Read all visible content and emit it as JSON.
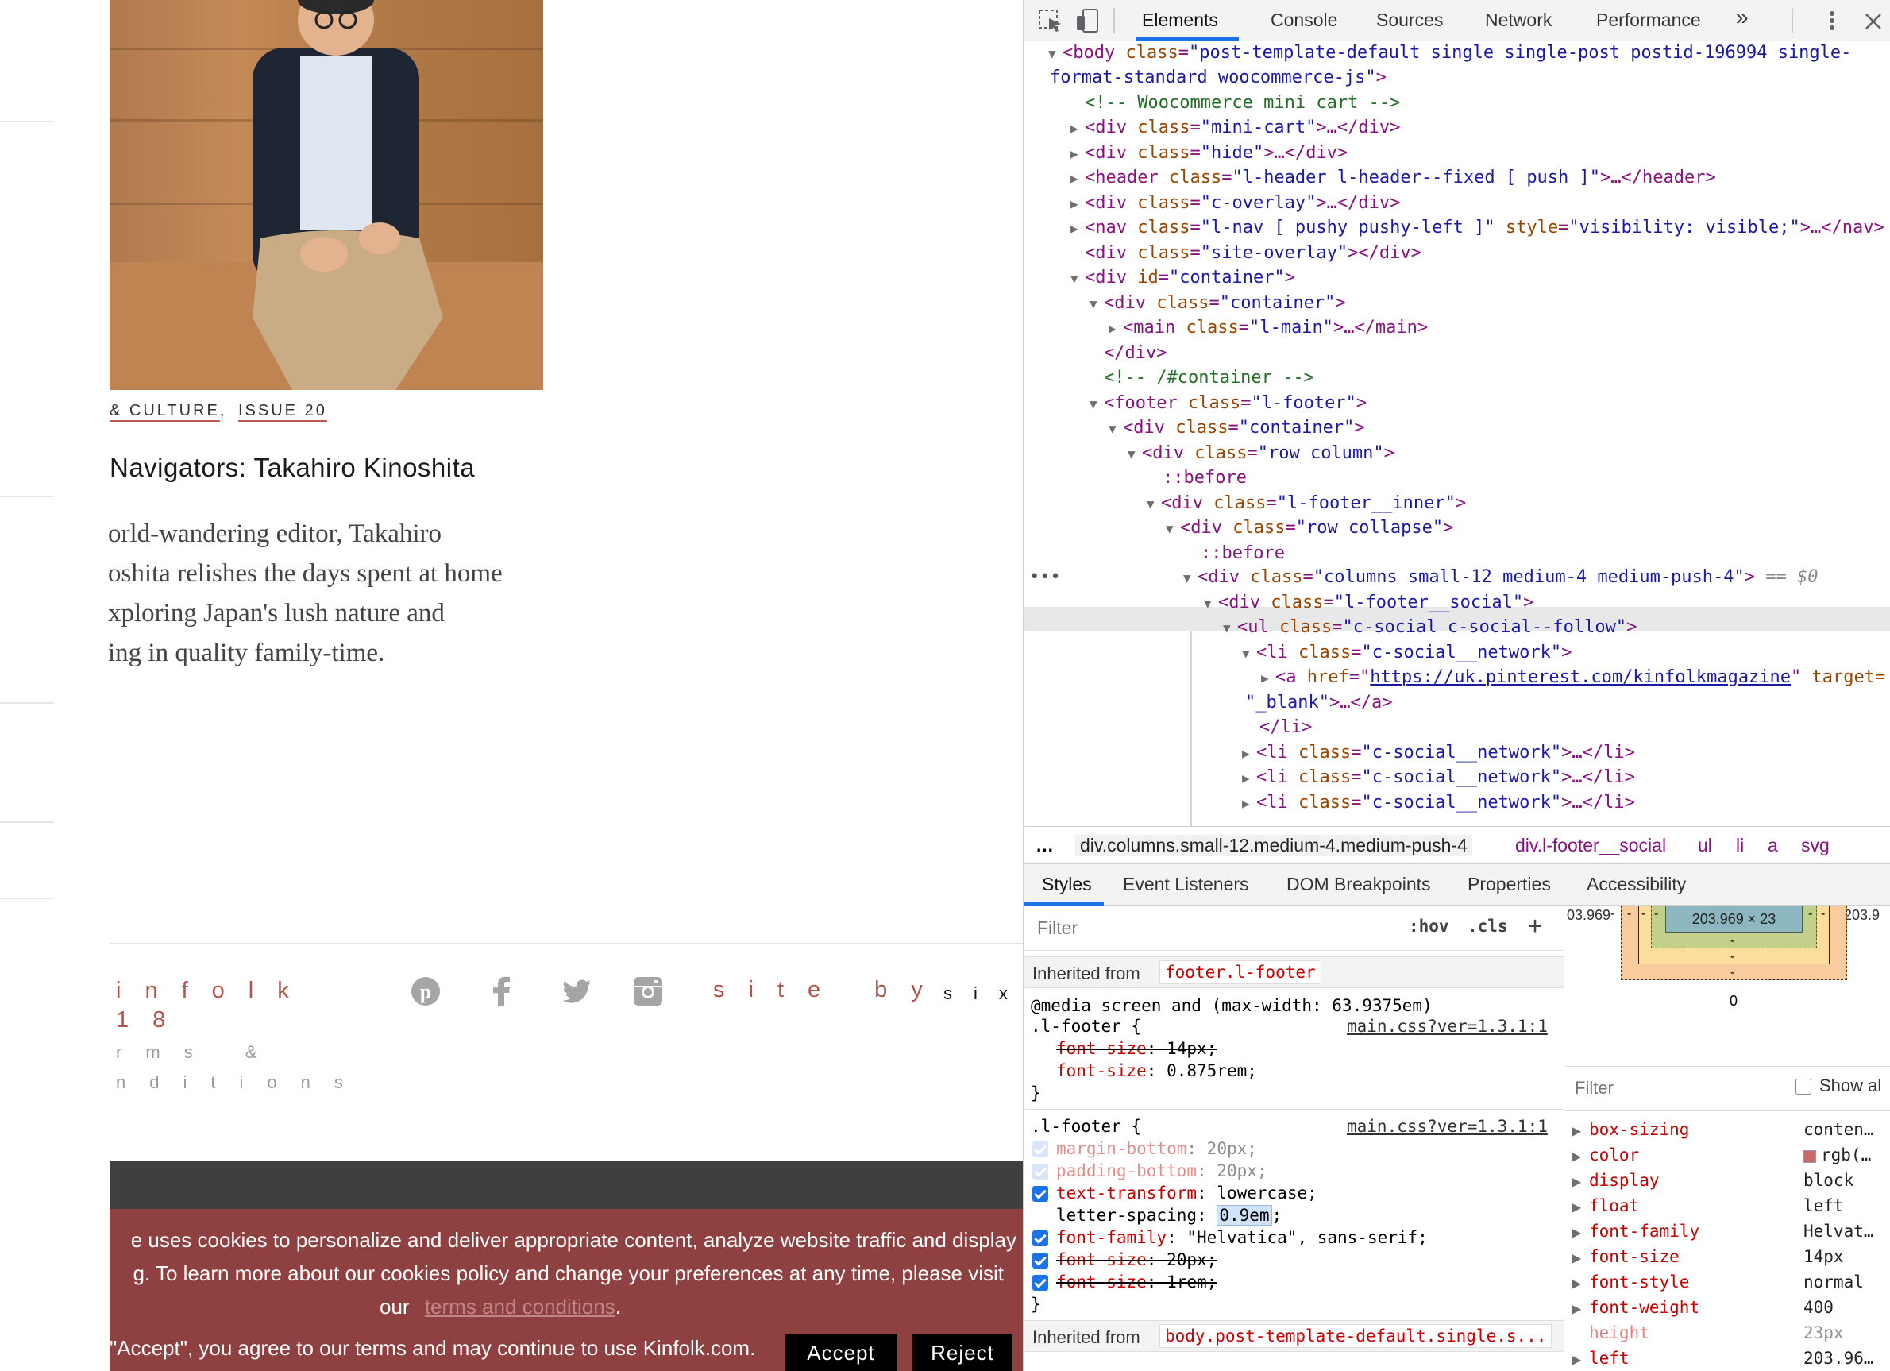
{
  "article": {
    "category_partial": "& CULTURE",
    "separator": ",",
    "issue": "ISSUE 20",
    "title_partial": "Navigators: Takahiro Kinoshita",
    "excerpt_lines": [
      "orld-wandering editor, Takahiro",
      "oshita relishes the days spent at home",
      "xploring Japan's lush nature and",
      "ing in quality family-time."
    ]
  },
  "footer": {
    "brand_line1": "infolk",
    "brand_line2": "18",
    "terms_line1": "rms &",
    "terms_line2": "nditions",
    "site_by": "site by",
    "six": "six",
    "social_icons": [
      "pinterest-icon",
      "facebook-icon",
      "twitter-icon",
      "instagram-icon"
    ]
  },
  "cookie_banner": {
    "line1": "e uses cookies to personalize and deliver appropriate content, analyze website traffic and display",
    "line2": "g. To learn more about our cookies policy and change your preferences at any time, please visit",
    "line3_prefix": "our",
    "link_text": "terms and conditions",
    "line3_suffix": ".",
    "line4": "\"Accept\", you agree to our terms and may continue to use Kinfolk.com.",
    "accept_label": "Accept",
    "reject_label": "Reject"
  },
  "devtools": {
    "tabs": [
      "Elements",
      "Console",
      "Sources",
      "Network",
      "Performance"
    ],
    "more_tabs": "»",
    "dom": {
      "body_open": "<body",
      "body_attr": "class",
      "body_class_1": "\"post-template-default single single-post postid-196994 single-",
      "body_class_2": "format-standard woocommerce-js\"",
      "comment_cart": "<!-- Woocommerce mini cart -->",
      "minicart_class": "\"mini-cart\"",
      "hide_class": "\"hide\"",
      "header_class": "\"l-header l-header--fixed [ push ]\"",
      "overlay_class": "\"c-overlay\"",
      "nav_class": "\"l-nav [ pushy pushy-left ]\"",
      "nav_style": "\"visibility: visible;\"",
      "site_overlay_class": "\"site-overlay\"",
      "container_id": "\"container\"",
      "container_class": "\"container\"",
      "main_class": "\"l-main\"",
      "comment_container": "<!-- /#container -->",
      "footer_class": "\"l-footer\"",
      "row_column_class": "\"row column\"",
      "before": "::before",
      "footer_inner_class": "\"l-footer__inner\"",
      "row_collapse_class": "\"row collapse\"",
      "columns_class": "\"columns small-12 medium-4 medium-push-4\"",
      "selected_marker": "== $0",
      "footer_social_class": "\"l-footer__social\"",
      "ul_class": "\"c-social c-social--follow\"",
      "li_class": "\"c-social__network\"",
      "a_href": "https://uk.pinterest.com/kinfolkmagazine",
      "a_target_attr": "target=",
      "a_target_val": "\"_blank\"",
      "ellipsis": "…"
    },
    "breadcrumbs": [
      "…",
      "div.columns.small-12.medium-4.medium-push-4",
      "div.l-footer__social",
      "ul",
      "li",
      "a",
      "svg"
    ],
    "subtabs": [
      "Styles",
      "Event Listeners",
      "DOM Breakpoints",
      "Properties",
      "Accessibility"
    ],
    "styles": {
      "filter_placeholder": "Filter",
      "hov": ":hov",
      "cls": ".cls",
      "plus": "+",
      "inherited_label": "Inherited from",
      "inherited_from_1": "footer.l-footer",
      "media_query": "@media screen and (max-width: 63.9375em)",
      "rule1_selector": ".l-footer {",
      "rule1_source": "main.css?ver=1.3.1:1",
      "rule1_decls": [
        {
          "prop": "font-size",
          "value": "14px",
          "struck": true
        },
        {
          "prop": "font-size",
          "value": "0.875rem",
          "struck": false
        }
      ],
      "close_brace": "}",
      "rule2_selector": ".l-footer {",
      "rule2_source": "main.css?ver=1.3.1:1",
      "rule2_decls": [
        {
          "prop": "margin-bottom",
          "value": "20px",
          "state": "inactive"
        },
        {
          "prop": "padding-bottom",
          "value": "20px",
          "state": "inactive"
        },
        {
          "prop": "text-transform",
          "value": "lowercase",
          "state": "active"
        },
        {
          "prop": "letter-spacing",
          "value": "0.9em",
          "state": "editing"
        },
        {
          "prop": "font-family",
          "value": "\"Helvatica\", sans-serif",
          "state": "active"
        },
        {
          "prop": "font-size",
          "value": "20px",
          "state": "struck"
        },
        {
          "prop": "font-size",
          "value": "1rem",
          "state": "struck"
        }
      ],
      "inherited_from_2": "body.post-template-default.single.s..."
    },
    "box_model": {
      "size": "203.969 × 23",
      "left_value": "03.969",
      "right_value": "-203.9",
      "dash": "-",
      "bottom_value": "0"
    },
    "computed": {
      "filter_placeholder": "Filter",
      "show_all": "Show al",
      "props": [
        {
          "name": "box-sizing",
          "value": "conten…"
        },
        {
          "name": "color",
          "value": "rgb(…",
          "swatch": "#c76a66"
        },
        {
          "name": "display",
          "value": "block"
        },
        {
          "name": "float",
          "value": "left"
        },
        {
          "name": "font-family",
          "value": "Helvat…"
        },
        {
          "name": "font-size",
          "value": "14px"
        },
        {
          "name": "font-style",
          "value": "normal"
        },
        {
          "name": "font-weight",
          "value": "400"
        },
        {
          "name": "height",
          "value": "23px",
          "dim": true
        },
        {
          "name": "left",
          "value": "203.96…"
        }
      ]
    }
  }
}
